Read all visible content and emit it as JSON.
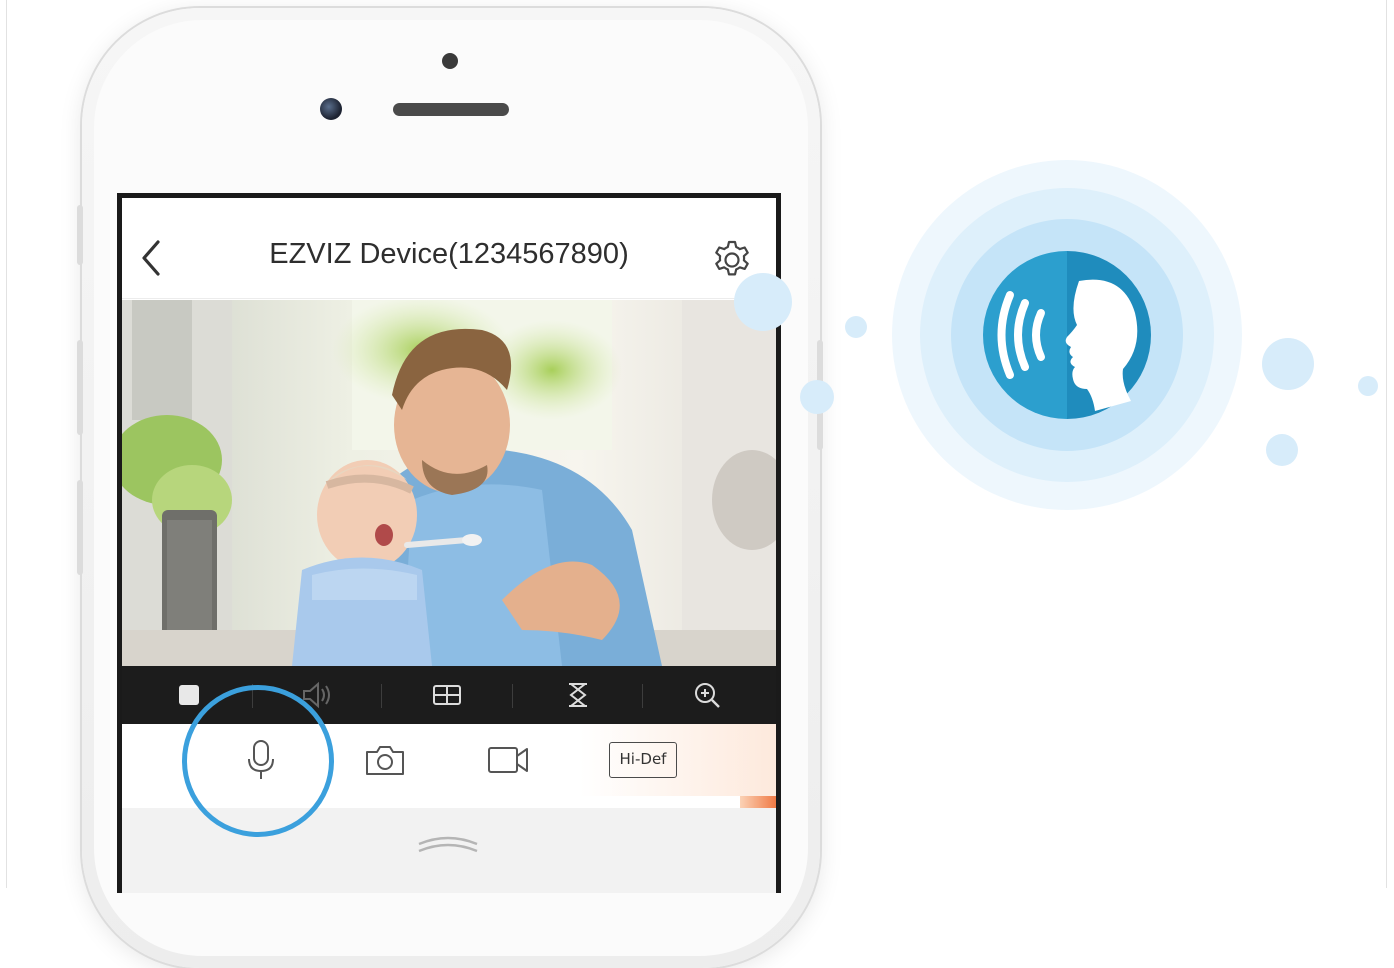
{
  "app": {
    "header": {
      "title": "EZVIZ Device(1234567890)",
      "back_icon": "chevron-left-icon",
      "settings_icon": "gear-icon"
    },
    "video": {
      "description": "live camera view"
    },
    "playback_toolbar": {
      "items": [
        {
          "icon": "stop-icon"
        },
        {
          "icon": "speaker-icon"
        },
        {
          "icon": "multi-screen-icon"
        },
        {
          "icon": "ptz-icon"
        },
        {
          "icon": "zoom-in-icon"
        }
      ]
    },
    "controls": {
      "talk_icon": "microphone-icon",
      "snapshot_icon": "camera-icon",
      "record_icon": "video-camera-icon",
      "quality_label": "Hi-Def"
    },
    "expand_icon": "chevron-up-double-icon"
  },
  "graphic": {
    "voice_icon": "two-way-talk-icon",
    "colors": {
      "accent_blue": "#3ba0dd",
      "badge_blue": "#2aa2d1",
      "badge_dark": "#1f8ab8"
    }
  }
}
